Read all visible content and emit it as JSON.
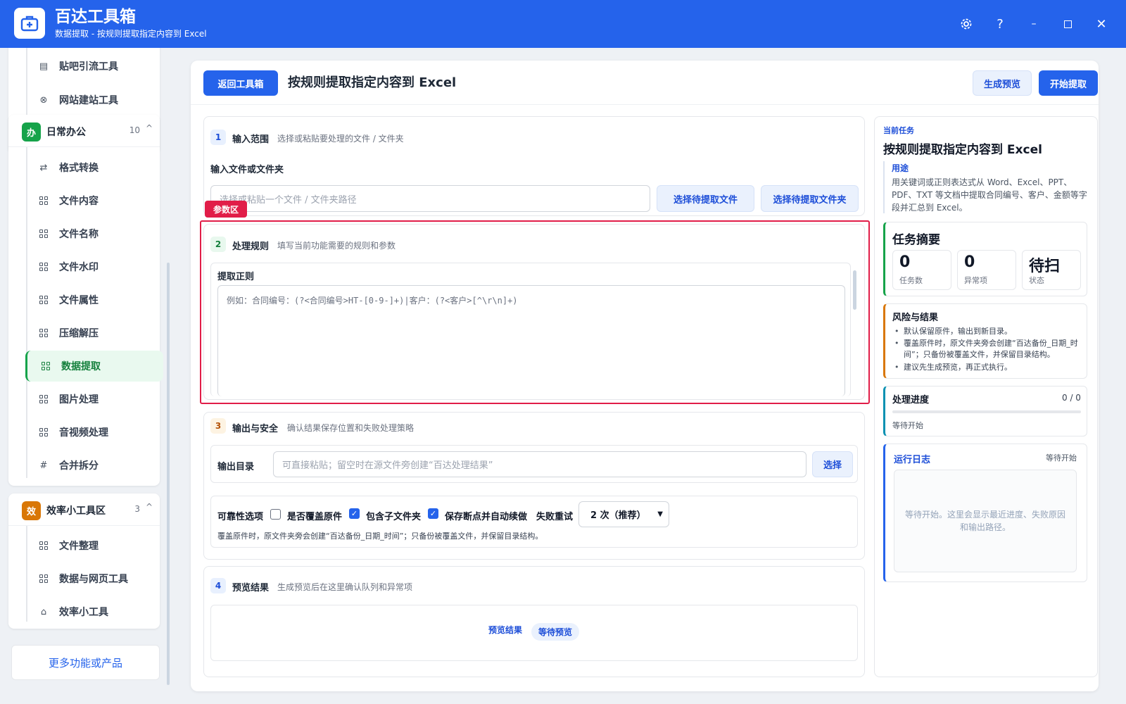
{
  "window": {
    "title": "百达工具箱",
    "subtitle": "数据提取 - 按规则提取指定内容到 Excel"
  },
  "sidebar": {
    "top_items": [
      {
        "label": "贴吧引流工具"
      },
      {
        "label": "网站建站工具"
      }
    ],
    "groups": [
      {
        "badge": "办",
        "title": "日常办公",
        "count": "10",
        "color": "#16a34a",
        "items": [
          {
            "label": "格式转换"
          },
          {
            "label": "文件内容"
          },
          {
            "label": "文件名称"
          },
          {
            "label": "文件水印"
          },
          {
            "label": "文件属性"
          },
          {
            "label": "压缩解压"
          },
          {
            "label": "数据提取"
          },
          {
            "label": "图片处理"
          },
          {
            "label": "音视频处理"
          },
          {
            "label": "合并拆分"
          }
        ]
      },
      {
        "badge": "效",
        "title": "效率小工具区",
        "count": "3",
        "color": "#d97706",
        "items": [
          {
            "label": "文件整理"
          },
          {
            "label": "数据与网页工具"
          },
          {
            "label": "效率小工具"
          }
        ]
      }
    ],
    "active_item": "数据提取",
    "more_button": "更多功能或产品"
  },
  "header": {
    "back_button": "返回工具箱",
    "title": "按规则提取指定内容到 Excel",
    "preview_button": "生成预览",
    "start_button": "开始提取"
  },
  "steps": {
    "input": {
      "no": "1",
      "title": "输入范围",
      "desc": "选择或粘贴要处理的文件 / 文件夹",
      "field_label": "输入文件或文件夹",
      "placeholder": "选择或粘贴一个文件 / 文件夹路径",
      "btn_files": "选择待提取文件",
      "btn_folder": "选择待提取文件夹"
    },
    "annotation_tag": "参数区",
    "rules": {
      "no": "2",
      "title": "处理规则",
      "desc": "填写当前功能需要的规则和参数",
      "field_label": "提取正则",
      "placeholder": "例如：合同编号：(?<合同编号>HT-[0-9-]+)|客户：(?<客户>[^\\r\\n]+)"
    },
    "output": {
      "no": "3",
      "title": "输出与安全",
      "desc": "确认结果保存位置和失败处理策略",
      "dir_label": "输出目录",
      "dir_placeholder": "可直接粘贴；留空时在源文件旁创建“百达处理结果”",
      "choose_button": "选择",
      "reliability_label": "可靠性选项",
      "opt_overwrite": "是否覆盖原件",
      "opt_overwrite_checked": false,
      "opt_subfolders": "包含子文件夹",
      "opt_subfolders_checked": true,
      "opt_resume": "保存断点并自动续做",
      "opt_resume_checked": true,
      "retry_label": "失败重试",
      "retry_value": "2 次（推荐）",
      "note": "覆盖原件时，原文件夹旁会创建“百达备份_日期_时间”；只备份被覆盖文件，并保留目录结构。"
    },
    "preview": {
      "no": "4",
      "title": "预览结果",
      "desc": "生成预览后在这里确认队列和异常项",
      "label": "预览结果",
      "badge": "等待预览"
    }
  },
  "right_panel": {
    "section_tag": "当前任务",
    "task_title": "按规则提取指定内容到 Excel",
    "usage_title": "用途",
    "usage_text": "用关键词或正则表达式从 Word、Excel、PPT、PDF、TXT 等文档中提取合同编号、客户、金额等字段并汇总到 Excel。",
    "summary_title": "任务摘要",
    "stats": [
      {
        "value": "0",
        "label": "任务数"
      },
      {
        "value": "0",
        "label": "异常项"
      },
      {
        "value": "待扫",
        "label": "状态"
      }
    ],
    "risk_title": "风险与结果",
    "risk_items": [
      "默认保留原件，输出到新目录。",
      "覆盖原件时，原文件夹旁会创建“百达备份_日期_时间”；只备份被覆盖文件，并保留目录结构。",
      "建议先生成预览，再正式执行。"
    ],
    "progress_title": "处理进度",
    "progress_count": "0 / 0",
    "progress_value": 0,
    "progress_status": "等待开始",
    "log_title": "运行日志",
    "log_status": "等待开始",
    "log_text": "等待开始。这里会显示最近进度、失败原因和输出路径。"
  },
  "colors": {
    "primary": "#2563eb",
    "green": "#16a34a",
    "orange": "#d97706",
    "red": "#e11d48"
  }
}
